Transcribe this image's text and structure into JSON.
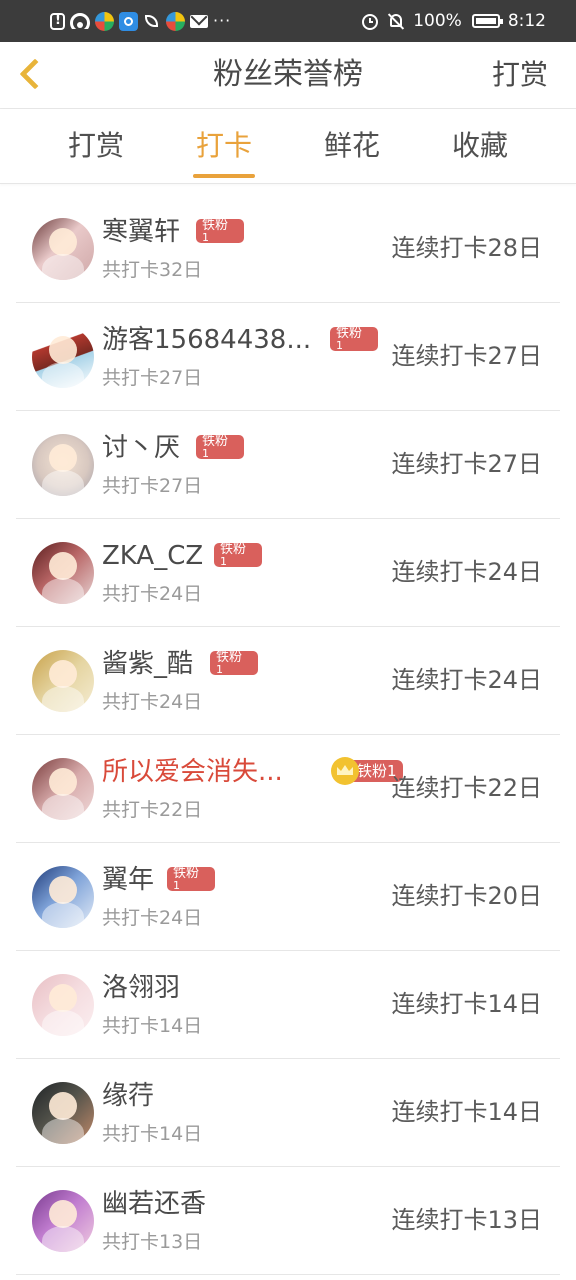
{
  "status_bar": {
    "more": "···",
    "battery": "100%",
    "time": "8:12"
  },
  "header": {
    "title": "粉丝荣誉榜",
    "action": "打赏"
  },
  "tabs": [
    {
      "label": "打赏",
      "active": false
    },
    {
      "label": "打卡",
      "active": true
    },
    {
      "label": "鲜花",
      "active": false
    },
    {
      "label": "收藏",
      "active": false
    }
  ],
  "colors": {
    "accent": "#e9a23b",
    "badge": "#d9605c",
    "highlight_name": "#d94a3a"
  },
  "fans": [
    {
      "name": "寒翼轩",
      "badge_title": "铁粉",
      "badge_level": "1",
      "total": "共打卡32日",
      "streak": "连续打卡28日"
    },
    {
      "name": "游客15684438...",
      "badge_title": "铁粉",
      "badge_level": "1",
      "total": "共打卡27日",
      "streak": "连续打卡27日"
    },
    {
      "name": "讨丶厌",
      "badge_title": "铁粉",
      "badge_level": "1",
      "total": "共打卡27日",
      "streak": "连续打卡27日"
    },
    {
      "name": "ZKA_CZ",
      "badge_title": "铁粉",
      "badge_level": "1",
      "total": "共打卡24日",
      "streak": "连续打卡24日"
    },
    {
      "name": "酱紫_酷",
      "badge_title": "铁粉",
      "badge_level": "1",
      "total": "共打卡24日",
      "streak": "连续打卡24日"
    },
    {
      "name": "所以爱会消失...",
      "crown_badge": "铁粉1",
      "total": "共打卡22日",
      "streak": "连续打卡22日"
    },
    {
      "name": "翼年",
      "badge_title": "铁粉",
      "badge_level": "1",
      "total": "共打卡24日",
      "streak": "连续打卡20日"
    },
    {
      "name": "洛翎羽",
      "total": "共打卡14日",
      "streak": "连续打卡14日"
    },
    {
      "name": "缘荇",
      "total": "共打卡14日",
      "streak": "连续打卡14日"
    },
    {
      "name": "幽若还香",
      "total": "共打卡13日",
      "streak": "连续打卡13日"
    }
  ]
}
